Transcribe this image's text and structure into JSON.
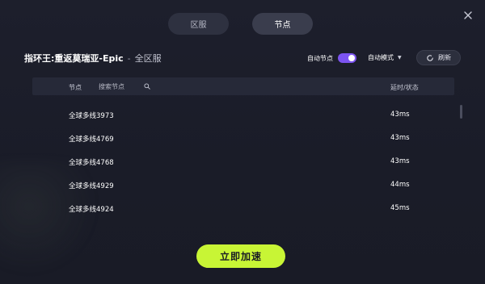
{
  "tabs": [
    {
      "label": "区服",
      "active": false
    },
    {
      "label": "节点",
      "active": true
    }
  ],
  "header": {
    "game_name": "指环王:重返莫瑞亚-Epic",
    "separator": "-",
    "server_name": "全区服"
  },
  "controls": {
    "auto_node_label": "自动节点",
    "auto_node_on": true,
    "auto_mode_label": "自动模式",
    "refresh_label": "刷新"
  },
  "table": {
    "col_node": "节点",
    "search_placeholder": "搜索节点",
    "col_latency": "延时/状态",
    "rows": [
      {
        "name": "全球多线3973",
        "latency": "43ms"
      },
      {
        "name": "全球多线4769",
        "latency": "43ms"
      },
      {
        "name": "全球多线4768",
        "latency": "43ms"
      },
      {
        "name": "全球多线4929",
        "latency": "44ms"
      },
      {
        "name": "全球多线4924",
        "latency": "45ms"
      }
    ]
  },
  "actions": {
    "accelerate_label": "立即加速"
  },
  "colors": {
    "accent": "#7c54f0",
    "primary_button": "#c8f535",
    "background": "#1b1d29"
  },
  "icons": [
    "close-icon",
    "search-icon",
    "refresh-icon",
    "caret-down-icon"
  ]
}
